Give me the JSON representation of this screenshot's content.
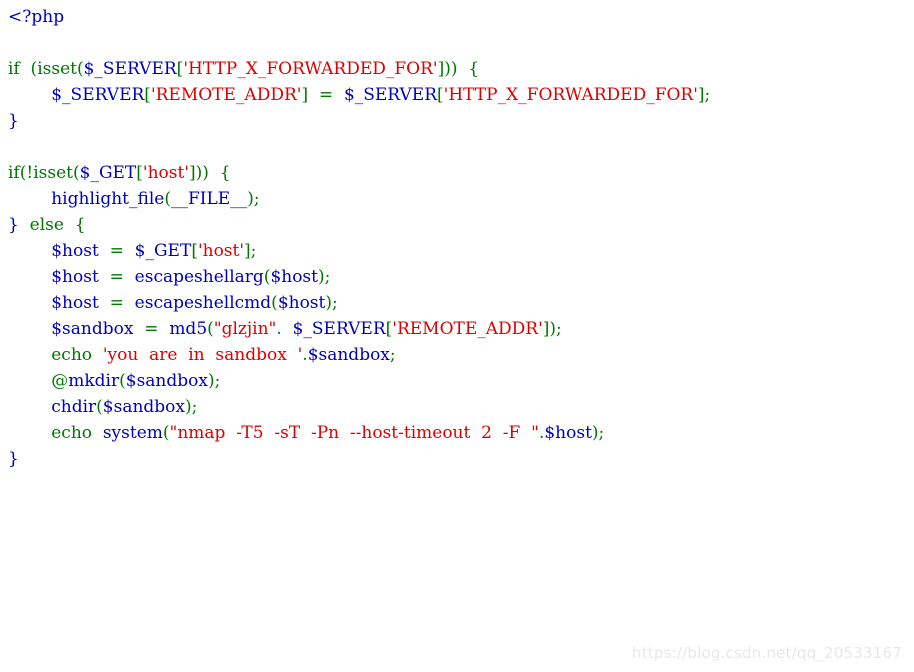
{
  "page": {
    "title": "PHP source listing",
    "background_color": "#ffffff",
    "language": "php"
  },
  "theme": {
    "default_color": "#0000BB",
    "keyword_color": "#007700",
    "string_color": "#DD0000",
    "comment_color": "#FF8000",
    "html_color": "#000000",
    "watermark_color": "#e8e8e8"
  },
  "watermark": {
    "text": "https://blog.csdn.net/qq_20533167"
  },
  "code": {
    "lines": [
      {
        "n": 1,
        "text": "<?php",
        "tokens": [
          {
            "t": "<?php",
            "c": "default"
          }
        ]
      },
      {
        "n": 2,
        "text": "",
        "tokens": []
      },
      {
        "n": 3,
        "text": "if  (isset($_SERVER['HTTP_X_FORWARDED_FOR']))  {",
        "tokens": [
          {
            "t": "if",
            "c": "keyword"
          },
          {
            "t": "  (",
            "c": "keyword"
          },
          {
            "t": "isset",
            "c": "keyword"
          },
          {
            "t": "(",
            "c": "keyword"
          },
          {
            "t": "$_SERVER",
            "c": "default"
          },
          {
            "t": "[",
            "c": "keyword"
          },
          {
            "t": "'HTTP_X_FORWARDED_FOR'",
            "c": "string"
          },
          {
            "t": "]",
            "c": "keyword"
          },
          {
            "t": "))  {",
            "c": "keyword"
          }
        ]
      },
      {
        "n": 4,
        "text": "        $_SERVER['REMOTE_ADDR']  =  $_SERVER['HTTP_X_FORWARDED_FOR'];",
        "tokens": [
          {
            "t": "        ",
            "c": "html"
          },
          {
            "t": "$_SERVER",
            "c": "default"
          },
          {
            "t": "[",
            "c": "keyword"
          },
          {
            "t": "'REMOTE_ADDR'",
            "c": "string"
          },
          {
            "t": "]",
            "c": "keyword"
          },
          {
            "t": "  =  ",
            "c": "keyword"
          },
          {
            "t": "$_SERVER",
            "c": "default"
          },
          {
            "t": "[",
            "c": "keyword"
          },
          {
            "t": "'HTTP_X_FORWARDED_FOR'",
            "c": "string"
          },
          {
            "t": "];",
            "c": "keyword"
          }
        ]
      },
      {
        "n": 5,
        "text": "}",
        "tokens": [
          {
            "t": "}",
            "c": "default"
          }
        ]
      },
      {
        "n": 6,
        "text": "",
        "tokens": []
      },
      {
        "n": 7,
        "text": "if(!isset($_GET['host']))  {",
        "tokens": [
          {
            "t": "if",
            "c": "keyword"
          },
          {
            "t": "(!",
            "c": "keyword"
          },
          {
            "t": "isset",
            "c": "keyword"
          },
          {
            "t": "(",
            "c": "keyword"
          },
          {
            "t": "$_GET",
            "c": "default"
          },
          {
            "t": "[",
            "c": "keyword"
          },
          {
            "t": "'host'",
            "c": "string"
          },
          {
            "t": "]",
            "c": "keyword"
          },
          {
            "t": "))  {",
            "c": "keyword"
          }
        ]
      },
      {
        "n": 8,
        "text": "        highlight_file(__FILE__);",
        "tokens": [
          {
            "t": "        ",
            "c": "html"
          },
          {
            "t": "highlight_file",
            "c": "default"
          },
          {
            "t": "(",
            "c": "keyword"
          },
          {
            "t": "__FILE__",
            "c": "default"
          },
          {
            "t": ");",
            "c": "keyword"
          }
        ]
      },
      {
        "n": 9,
        "text": "}  else  {",
        "tokens": [
          {
            "t": "}",
            "c": "default"
          },
          {
            "t": "  else  {",
            "c": "keyword"
          }
        ]
      },
      {
        "n": 10,
        "text": "        $host  =  $_GET['host'];",
        "tokens": [
          {
            "t": "        ",
            "c": "html"
          },
          {
            "t": "$host",
            "c": "default"
          },
          {
            "t": "  =  ",
            "c": "keyword"
          },
          {
            "t": "$_GET",
            "c": "default"
          },
          {
            "t": "[",
            "c": "keyword"
          },
          {
            "t": "'host'",
            "c": "string"
          },
          {
            "t": "];",
            "c": "keyword"
          }
        ]
      },
      {
        "n": 11,
        "text": "        $host  =  escapeshellarg($host);",
        "tokens": [
          {
            "t": "        ",
            "c": "html"
          },
          {
            "t": "$host",
            "c": "default"
          },
          {
            "t": "  =  ",
            "c": "keyword"
          },
          {
            "t": "escapeshellarg",
            "c": "default"
          },
          {
            "t": "(",
            "c": "keyword"
          },
          {
            "t": "$host",
            "c": "default"
          },
          {
            "t": ");",
            "c": "keyword"
          }
        ]
      },
      {
        "n": 12,
        "text": "        $host  =  escapeshellcmd($host);",
        "tokens": [
          {
            "t": "        ",
            "c": "html"
          },
          {
            "t": "$host",
            "c": "default"
          },
          {
            "t": "  =  ",
            "c": "keyword"
          },
          {
            "t": "escapeshellcmd",
            "c": "default"
          },
          {
            "t": "(",
            "c": "keyword"
          },
          {
            "t": "$host",
            "c": "default"
          },
          {
            "t": ");",
            "c": "keyword"
          }
        ]
      },
      {
        "n": 13,
        "text": "        $sandbox  =  md5(\"glzjin\".  $_SERVER['REMOTE_ADDR']);",
        "tokens": [
          {
            "t": "        ",
            "c": "html"
          },
          {
            "t": "$sandbox",
            "c": "default"
          },
          {
            "t": "  =  ",
            "c": "keyword"
          },
          {
            "t": "md5",
            "c": "default"
          },
          {
            "t": "(",
            "c": "keyword"
          },
          {
            "t": "\"glzjin\"",
            "c": "string"
          },
          {
            "t": ".  ",
            "c": "keyword"
          },
          {
            "t": "$_SERVER",
            "c": "default"
          },
          {
            "t": "[",
            "c": "keyword"
          },
          {
            "t": "'REMOTE_ADDR'",
            "c": "string"
          },
          {
            "t": "]);",
            "c": "keyword"
          }
        ]
      },
      {
        "n": 14,
        "text": "        echo  'you  are  in  sandbox  '.$sandbox;",
        "tokens": [
          {
            "t": "        ",
            "c": "html"
          },
          {
            "t": "echo",
            "c": "keyword"
          },
          {
            "t": "  ",
            "c": "html"
          },
          {
            "t": "'you  are  in  sandbox  '",
            "c": "string"
          },
          {
            "t": ".",
            "c": "keyword"
          },
          {
            "t": "$sandbox",
            "c": "default"
          },
          {
            "t": ";",
            "c": "keyword"
          }
        ]
      },
      {
        "n": 15,
        "text": "        @mkdir($sandbox);",
        "tokens": [
          {
            "t": "        ",
            "c": "html"
          },
          {
            "t": "@",
            "c": "keyword"
          },
          {
            "t": "mkdir",
            "c": "default"
          },
          {
            "t": "(",
            "c": "keyword"
          },
          {
            "t": "$sandbox",
            "c": "default"
          },
          {
            "t": ");",
            "c": "keyword"
          }
        ]
      },
      {
        "n": 16,
        "text": "        chdir($sandbox);",
        "tokens": [
          {
            "t": "        ",
            "c": "html"
          },
          {
            "t": "chdir",
            "c": "default"
          },
          {
            "t": "(",
            "c": "keyword"
          },
          {
            "t": "$sandbox",
            "c": "default"
          },
          {
            "t": ");",
            "c": "keyword"
          }
        ]
      },
      {
        "n": 17,
        "text": "        echo  system(\"nmap  -T5  -sT  -Pn  --host-timeout  2  -F  \".$host);",
        "tokens": [
          {
            "t": "        ",
            "c": "html"
          },
          {
            "t": "echo",
            "c": "keyword"
          },
          {
            "t": "  ",
            "c": "html"
          },
          {
            "t": "system",
            "c": "default"
          },
          {
            "t": "(",
            "c": "keyword"
          },
          {
            "t": "\"nmap  -T5  -sT  -Pn  --host-timeout  2  -F  \"",
            "c": "string"
          },
          {
            "t": ".",
            "c": "keyword"
          },
          {
            "t": "$host",
            "c": "default"
          },
          {
            "t": ");",
            "c": "keyword"
          }
        ]
      },
      {
        "n": 18,
        "text": "}",
        "tokens": [
          {
            "t": "}",
            "c": "default"
          }
        ]
      }
    ]
  }
}
